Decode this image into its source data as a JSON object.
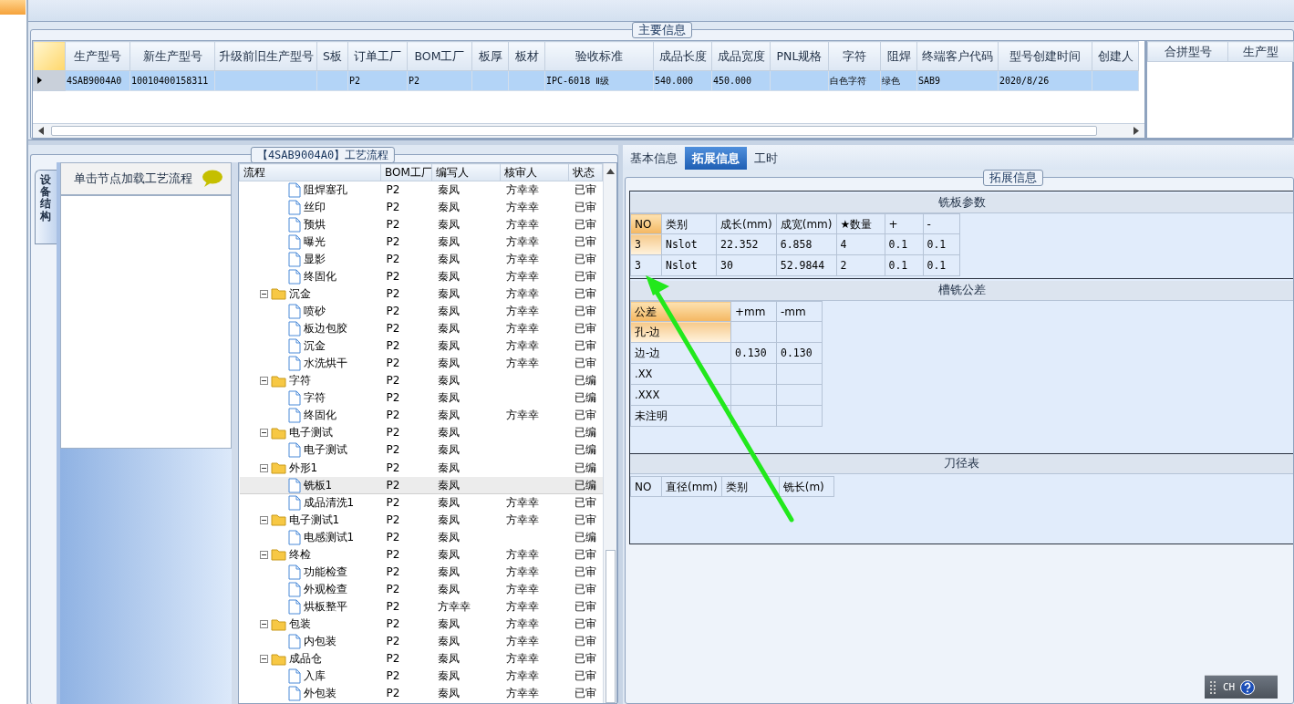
{
  "main_info": {
    "legend": "主要信息",
    "columns": [
      "生产型号",
      "新生产型号",
      "升级前旧生产型号",
      "S板",
      "订单工厂",
      "BOM工厂",
      "板厚",
      "板材",
      "验收标准",
      "成品长度",
      "成品宽度",
      "PNL规格",
      "字符",
      "阻焊",
      "终端客户代码",
      "型号创建时间",
      "创建人"
    ],
    "rows": [
      {
        "selected": true,
        "cells": [
          "4SAB9004A0",
          "10010400158311",
          "",
          "",
          "P2",
          "P2",
          "",
          "",
          "IPC-6018 Ⅱ级",
          "540.000",
          "450.000",
          "",
          "白色字符",
          "绿色",
          "SAB9",
          "2020/8/26",
          ""
        ]
      }
    ],
    "side_columns": [
      "合拼型号",
      "生产型"
    ]
  },
  "process": {
    "legend": "【4SAB9004A0】工艺流程",
    "side_tab": "设备结构",
    "hint": "单击节点加载工艺流程",
    "columns": [
      "流程",
      "BOM工厂",
      "编写人",
      "核审人",
      "状态"
    ],
    "tree": [
      {
        "children": [
          {
            "kind": "file",
            "selected": false,
            "cells": [
              "阻焊塞孔",
              "P2",
              "秦凤",
              "方幸幸",
              "已审"
            ]
          },
          {
            "kind": "file",
            "selected": false,
            "cells": [
              "丝印",
              "P2",
              "秦凤",
              "方幸幸",
              "已审"
            ]
          },
          {
            "kind": "file",
            "selected": false,
            "cells": [
              "预烘",
              "P2",
              "秦凤",
              "方幸幸",
              "已审"
            ]
          },
          {
            "kind": "file",
            "selected": false,
            "cells": [
              "曝光",
              "P2",
              "秦凤",
              "方幸幸",
              "已审"
            ]
          },
          {
            "kind": "file",
            "selected": false,
            "cells": [
              "显影",
              "P2",
              "秦凤",
              "方幸幸",
              "已审"
            ]
          },
          {
            "kind": "file",
            "selected": false,
            "cells": [
              "终固化",
              "P2",
              "秦凤",
              "方幸幸",
              "已审"
            ]
          }
        ]
      },
      {
        "kind": "folder",
        "selected": false,
        "cells": [
          "沉金",
          "P2",
          "秦凤",
          "方幸幸",
          "已审"
        ],
        "children": [
          {
            "kind": "file",
            "selected": false,
            "cells": [
              "喷砂",
              "P2",
              "秦凤",
              "方幸幸",
              "已审"
            ]
          },
          {
            "kind": "file",
            "selected": false,
            "cells": [
              "板边包胶",
              "P2",
              "秦凤",
              "方幸幸",
              "已审"
            ]
          },
          {
            "kind": "file",
            "selected": false,
            "cells": [
              "沉金",
              "P2",
              "秦凤",
              "方幸幸",
              "已审"
            ]
          },
          {
            "kind": "file",
            "selected": false,
            "cells": [
              "水洗烘干",
              "P2",
              "秦凤",
              "方幸幸",
              "已审"
            ]
          }
        ]
      },
      {
        "kind": "folder",
        "selected": false,
        "cells": [
          "字符",
          "P2",
          "秦凤",
          "",
          "已编"
        ],
        "children": [
          {
            "kind": "file",
            "selected": false,
            "cells": [
              "字符",
              "P2",
              "秦凤",
              "",
              "已编"
            ]
          },
          {
            "kind": "file",
            "selected": false,
            "cells": [
              "终固化",
              "P2",
              "秦凤",
              "方幸幸",
              "已审"
            ]
          }
        ]
      },
      {
        "kind": "folder",
        "selected": false,
        "cells": [
          "电子测试",
          "P2",
          "秦凤",
          "",
          "已编"
        ],
        "children": [
          {
            "kind": "file",
            "selected": false,
            "cells": [
              "电子测试",
              "P2",
              "秦凤",
              "",
              "已编"
            ]
          }
        ]
      },
      {
        "kind": "folder",
        "selected": false,
        "cells": [
          "外形1",
          "P2",
          "秦凤",
          "",
          "已编"
        ],
        "children": [
          {
            "kind": "file",
            "selected": true,
            "cells": [
              "铣板1",
              "P2",
              "秦凤",
              "",
              "已编"
            ]
          },
          {
            "kind": "file",
            "selected": false,
            "cells": [
              "成品清洗1",
              "P2",
              "秦凤",
              "方幸幸",
              "已审"
            ]
          }
        ]
      },
      {
        "kind": "folder",
        "selected": false,
        "cells": [
          "电子测试1",
          "P2",
          "秦凤",
          "方幸幸",
          "已审"
        ],
        "children": [
          {
            "kind": "file",
            "selected": false,
            "cells": [
              "电感测试1",
              "P2",
              "秦凤",
              "",
              "已编"
            ]
          }
        ]
      },
      {
        "kind": "folder",
        "selected": false,
        "cells": [
          "终检",
          "P2",
          "秦凤",
          "方幸幸",
          "已审"
        ],
        "children": [
          {
            "kind": "file",
            "selected": false,
            "cells": [
              "功能检查",
              "P2",
              "秦凤",
              "方幸幸",
              "已审"
            ]
          },
          {
            "kind": "file",
            "selected": false,
            "cells": [
              "外观检查",
              "P2",
              "秦凤",
              "方幸幸",
              "已审"
            ]
          },
          {
            "kind": "file",
            "selected": false,
            "cells": [
              "烘板整平",
              "P2",
              "方幸幸",
              "方幸幸",
              "已审"
            ]
          }
        ]
      },
      {
        "kind": "folder",
        "selected": false,
        "cells": [
          "包装",
          "P2",
          "秦凤",
          "方幸幸",
          "已审"
        ],
        "children": [
          {
            "kind": "file",
            "selected": false,
            "cells": [
              "内包装",
              "P2",
              "秦凤",
              "方幸幸",
              "已审"
            ]
          }
        ]
      },
      {
        "kind": "folder",
        "selected": false,
        "cells": [
          "成品仓",
          "P2",
          "秦凤",
          "方幸幸",
          "已审"
        ],
        "children": [
          {
            "kind": "file",
            "selected": false,
            "cells": [
              "入库",
              "P2",
              "秦凤",
              "方幸幸",
              "已审"
            ]
          },
          {
            "kind": "file",
            "selected": false,
            "cells": [
              "外包装",
              "P2",
              "秦凤",
              "方幸幸",
              "已审"
            ]
          }
        ]
      }
    ]
  },
  "detail": {
    "tabs": [
      {
        "label": "基本信息",
        "selected": false
      },
      {
        "label": "拓展信息",
        "selected": true
      },
      {
        "label": "工时",
        "selected": false
      }
    ],
    "legend": "拓展信息",
    "milling": {
      "title": "铣板参数",
      "columns": [
        "NO",
        "类别",
        "成长(mm)",
        "成宽(mm)",
        "★数量",
        "+",
        "-"
      ],
      "rows": [
        [
          "3",
          "Nslot",
          "22.352",
          "6.858",
          "4",
          "0.1",
          "0.1"
        ],
        [
          "3",
          "Nslot",
          "30",
          "52.9844",
          "2",
          "0.1",
          "0.1"
        ]
      ]
    },
    "tolerance": {
      "title": "槽铣公差",
      "columns": [
        "公差",
        "+mm",
        "-mm"
      ],
      "rows": [
        [
          "孔-边",
          "",
          ""
        ],
        [
          "边-边",
          "0.130",
          "0.130"
        ],
        [
          ".XX",
          "",
          ""
        ],
        [
          ".XXX",
          "",
          ""
        ],
        [
          "未注明",
          "",
          ""
        ]
      ]
    },
    "cutters": {
      "title": "刀径表",
      "columns": [
        "NO",
        "直径(mm)",
        "类别",
        "铣长(m)"
      ]
    }
  },
  "language_bar": {
    "label": "CH"
  }
}
